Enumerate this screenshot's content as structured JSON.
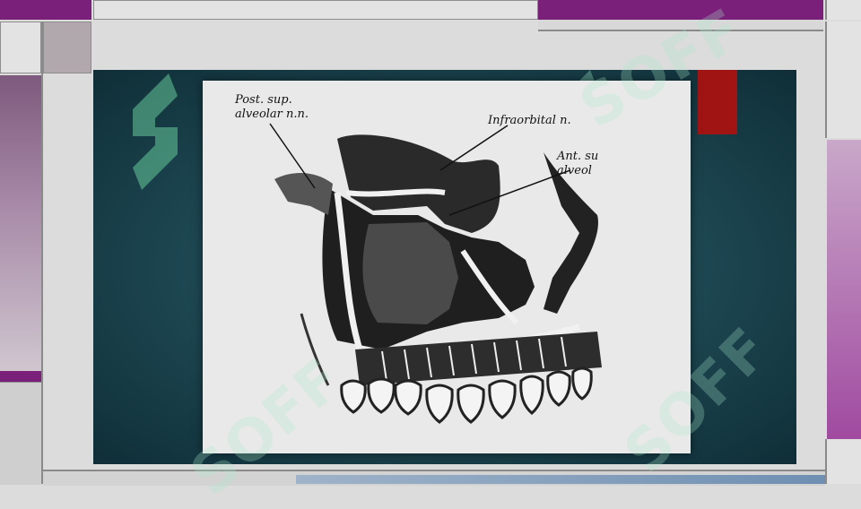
{
  "figure": {
    "labels": {
      "post_sup_line1": "Post. sup.",
      "post_sup_line2": "alveolar n.n.",
      "infraorbital": "Infraorbital n.",
      "ant_sup_line1": "Ant. su",
      "ant_sup_line2": "alveol"
    }
  },
  "watermark": {
    "text": "SOFF"
  },
  "colors": {
    "purple_accent": "#7a1f7a",
    "slide_teal": "#1c4550",
    "red_accent": "#a11414"
  },
  "icons": [
    "watermark-logo-icon"
  ]
}
